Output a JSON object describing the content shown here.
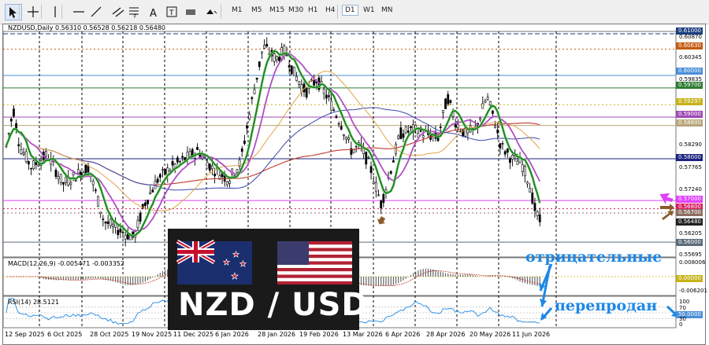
{
  "toolbar": {
    "tools": [
      "cursor-icon",
      "crosshair-icon",
      "vertical-line-icon",
      "horizontal-line-icon",
      "trendline-icon",
      "channel-icon",
      "fibonacci-icon",
      "text-icon",
      "text-label-icon",
      "rectangle-icon",
      "shapes-icon"
    ],
    "timeframes": [
      "M1",
      "M5",
      "M15",
      "M30",
      "H1",
      "H4",
      "D1",
      "W1",
      "MN"
    ],
    "active_timeframe": "D1"
  },
  "chart": {
    "symbol_title": "NZDUSD,Daily  0.56310 0.56528 0.56218 0.56480",
    "macd_title": "MACD(12,26,9) -0.005471 -0.003352",
    "rsi_title": "RSI(14) 28.5121",
    "watermark": "NZD / USD",
    "price_scale": [
      {
        "text": "0.61000",
        "style": "tag",
        "color": "#1a3e7e"
      },
      {
        "text": "0.60870",
        "style": "plain"
      },
      {
        "text": "0.60630",
        "style": "tag",
        "color": "#c55a11"
      },
      {
        "text": "0.60345",
        "style": "plain"
      },
      {
        "text": "0.60000",
        "style": "tag",
        "color": "#4a8fd8"
      },
      {
        "text": "0.59835",
        "style": "plain"
      },
      {
        "text": "0.59700",
        "style": "tag",
        "color": "#2e7d32"
      },
      {
        "text": "0.59297",
        "style": "tag",
        "color": "#c7b21a"
      },
      {
        "text": "0.59000",
        "style": "tag",
        "color": "#a04ab5"
      },
      {
        "text": "0.58800",
        "style": "tag",
        "color": "#b8a47a"
      },
      {
        "text": "0.58290",
        "style": "plain"
      },
      {
        "text": "0.58000",
        "style": "tag",
        "color": "#1a237e"
      },
      {
        "text": "0.57765",
        "style": "plain"
      },
      {
        "text": "0.57240",
        "style": "plain"
      },
      {
        "text": "0.57000",
        "style": "tag",
        "color": "#e040fb"
      },
      {
        "text": "0.56800",
        "style": "tag",
        "color": "#d81b60"
      },
      {
        "text": "0.56700",
        "style": "tag",
        "color": "#8d6e63"
      },
      {
        "text": "0.56480",
        "style": "tag",
        "color": "#212121"
      },
      {
        "text": "0.56205",
        "style": "plain"
      },
      {
        "text": "0.56000",
        "style": "tag",
        "color": "#5c6b7a"
      },
      {
        "text": "0.55695",
        "style": "plain"
      }
    ],
    "macd_scale": [
      {
        "text": "0.008006",
        "style": "plain"
      },
      {
        "text": "0.00000",
        "style": "tag",
        "color": "#c7b21a"
      },
      {
        "text": "-0.006201",
        "style": "plain"
      }
    ],
    "rsi_scale": [
      {
        "text": "100",
        "style": "plain"
      },
      {
        "text": "70",
        "style": "plain"
      },
      {
        "text": "50.0000",
        "style": "tag",
        "color": "#4a8fd8"
      },
      {
        "text": "30",
        "style": "plain"
      },
      {
        "text": "0",
        "style": "plain"
      }
    ],
    "dates": [
      "12 Sep 2025",
      "6 Oct 2025",
      "28 Oct 2025",
      "19 Nov 2025",
      "11 Dec 2025",
      "6 Jan 2026",
      "28 Jan 2026",
      "19 Feb 2026",
      "13 Mar 2026",
      "6 Apr 2026",
      "28 Apr 2026",
      "20 May 2026",
      "11 Jun 2026"
    ]
  },
  "annotations": {
    "negative": "отрицательные",
    "oversold": "перепродан"
  },
  "colors": {
    "up_candle": "#000000",
    "down_candle": "#000000",
    "ma_fast": "#1b7a1b",
    "ma_fast_light": "#7bd47b",
    "ma_mid": "#b14fc5",
    "ma_slow": "#e0a54a",
    "ma_200": "#c0392b",
    "ma_blue": "#3949ab",
    "annotation": "#1e88e5",
    "arrow_brown": "#8b5a2b",
    "arrow_magenta": "#e040fb"
  }
}
